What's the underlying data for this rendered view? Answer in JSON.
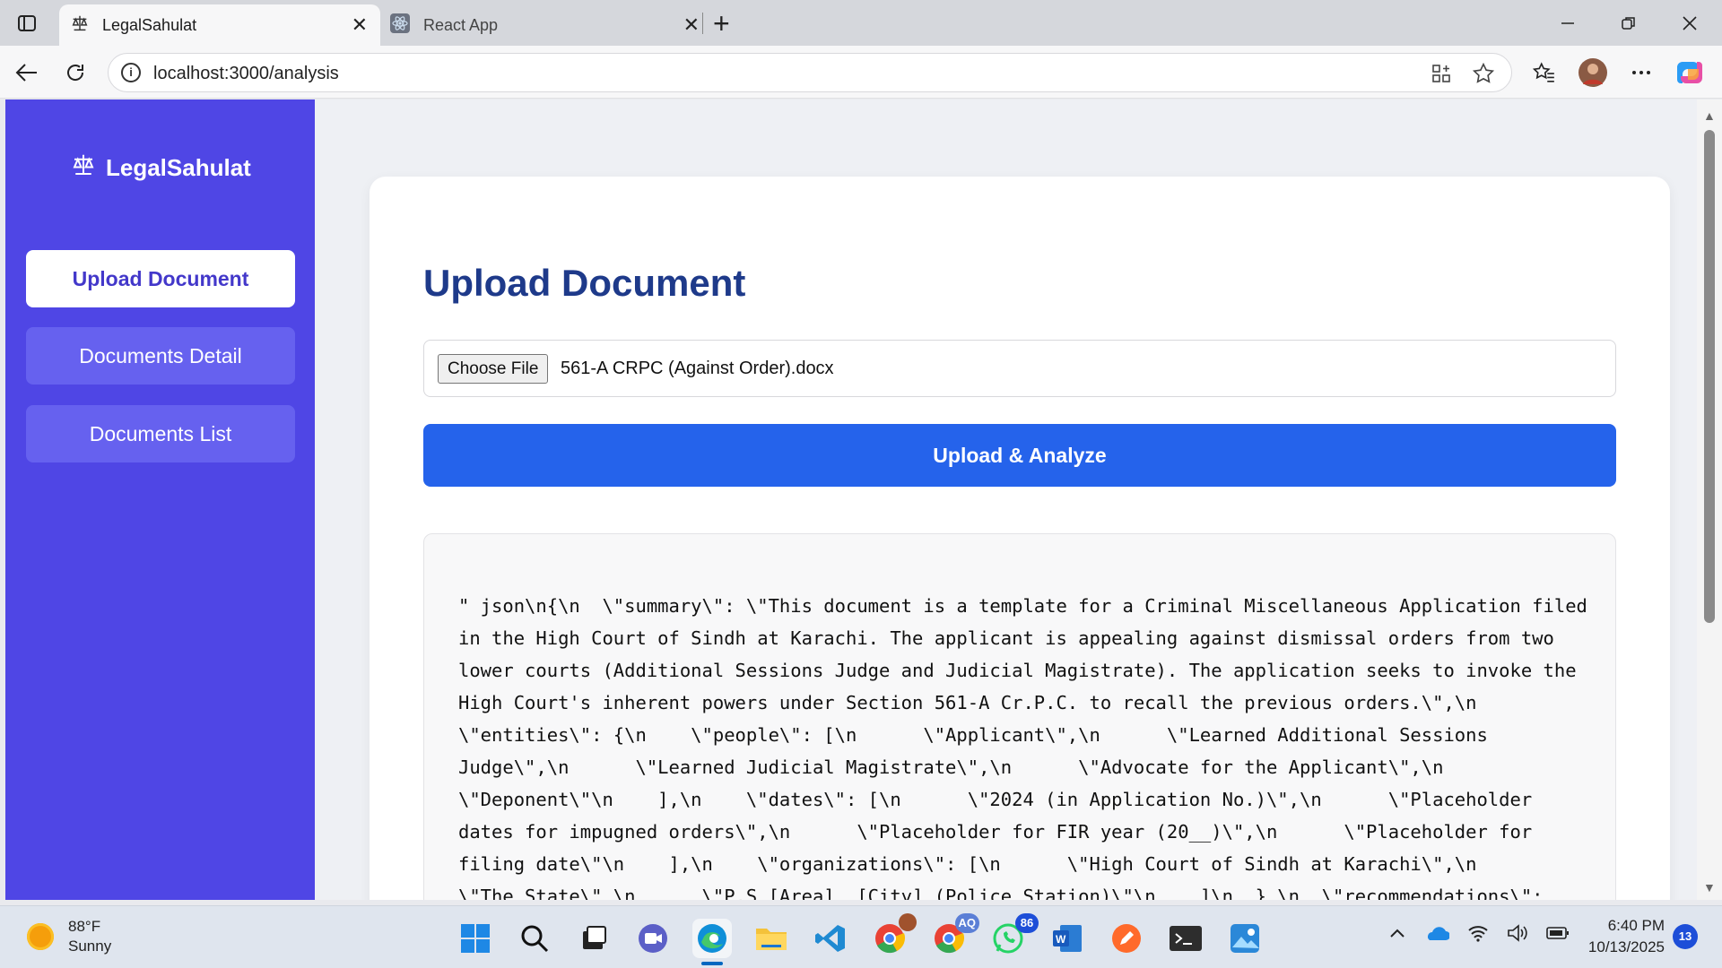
{
  "browser": {
    "tabs": [
      {
        "title": "LegalSahulat",
        "active": true
      },
      {
        "title": "React App",
        "active": false
      }
    ],
    "url": "localhost:3000/analysis"
  },
  "sidebar": {
    "brand": "LegalSahulat",
    "items": [
      {
        "label": "Upload Document",
        "active": true
      },
      {
        "label": "Documents Detail",
        "active": false
      },
      {
        "label": "Documents List",
        "active": false
      }
    ]
  },
  "main": {
    "title": "Upload Document",
    "file_input": {
      "button_label": "Choose File",
      "file_name": "561-A CRPC (Against Order).docx"
    },
    "upload_button": "Upload & Analyze",
    "result_text": "\" json\\n{\\n  \\\"summary\\\": \\\"This document is a template for a Criminal Miscellaneous Application filed in the High Court of Sindh at Karachi. The applicant is appealing against dismissal orders from two lower courts (Additional Sessions Judge and Judicial Magistrate). The application seeks to invoke the High Court's inherent powers under Section 561-A Cr.P.C. to recall the previous orders.\\\",\\n  \\\"entities\\\": {\\n    \\\"people\\\": [\\n      \\\"Applicant\\\",\\n      \\\"Learned Additional Sessions Judge\\\",\\n      \\\"Learned Judicial Magistrate\\\",\\n      \\\"Advocate for the Applicant\\\",\\n      \\\"Deponent\\\"\\n    ],\\n    \\\"dates\\\": [\\n      \\\"2024 (in Application No.)\\\",\\n      \\\"Placeholder dates for impugned orders\\\",\\n      \\\"Placeholder for FIR year (20__)\\\",\\n      \\\"Placeholder for filing date\\\"\\n    ],\\n    \\\"organizations\\\": [\\n      \\\"High Court of Sindh at Karachi\\\",\\n      \\\"The State\\\",\\n      \\\"P.S [Area], [City] (Police Station)\\\"\\n    ]\\n  },\\n  \\\"recommendations\\\":"
  },
  "taskbar": {
    "weather_temp": "88°F",
    "weather_desc": "Sunny",
    "time": "6:40 PM",
    "date": "10/13/2025",
    "notification_count": "13",
    "whatsapp_badge": "86",
    "chrome_badge": "AQ"
  }
}
